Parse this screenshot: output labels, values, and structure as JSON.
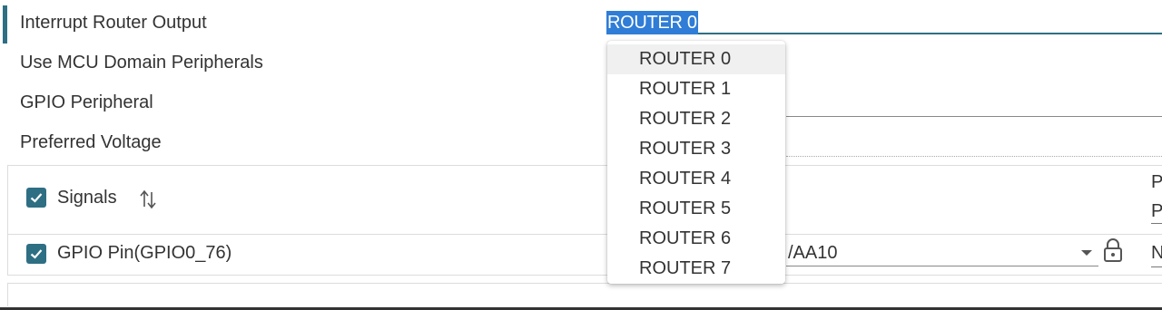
{
  "properties": {
    "interrupt_router_output": "Interrupt Router Output",
    "use_mcu_domain_peripherals": "Use MCU Domain Peripherals",
    "gpio_peripheral": "GPIO Peripheral",
    "preferred_voltage": "Preferred Voltage"
  },
  "router_select": {
    "selected_value": "ROUTER 0",
    "options": [
      "ROUTER 0",
      "ROUTER 1",
      "ROUTER 2",
      "ROUTER 3",
      "ROUTER 4",
      "ROUTER 5",
      "ROUTER 6",
      "ROUTER 7"
    ]
  },
  "signals": {
    "header_label": "Signals",
    "header_checked": true,
    "sort_icon": "sort-arrows-icon",
    "right_edge_top": "P",
    "right_edge_bottom": "P",
    "row": {
      "label": "GPIO Pin(GPIO0_76)",
      "checked": true,
      "pin_value": "/AA10",
      "lock_icon": "lock-icon",
      "right_edge": "N"
    }
  },
  "colors": {
    "accent": "#2e6f84",
    "selection": "#2f7dd6"
  }
}
